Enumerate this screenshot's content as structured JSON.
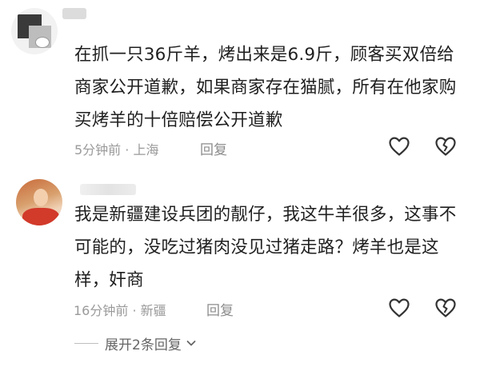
{
  "comments": [
    {
      "text": "在抓一只36斤羊，烤出来是6.9斤，顾客买双倍给商家公开道歉，如果商家存在猫腻，所有在他家购买烤羊的十倍赔偿公开道歉",
      "time": "5分钟前",
      "location": "上海",
      "reply_label": "回复",
      "like_icon": "heart-outline-icon",
      "dislike_icon": "broken-heart-icon"
    },
    {
      "text": "我是新疆建设兵团的靓仔，我这牛羊很多，这事不可能的，没吃过猪肉没见过猪走路？烤羊也是这样，奸商",
      "time": "16分钟前",
      "location": "新疆",
      "reply_label": "回复",
      "like_icon": "heart-outline-icon",
      "dislike_icon": "broken-heart-icon"
    }
  ],
  "expand_replies": {
    "label": "展开2条回复"
  },
  "colors": {
    "meta": "#9a9a9a",
    "text": "#1f1f1f",
    "icon": "#333333"
  }
}
